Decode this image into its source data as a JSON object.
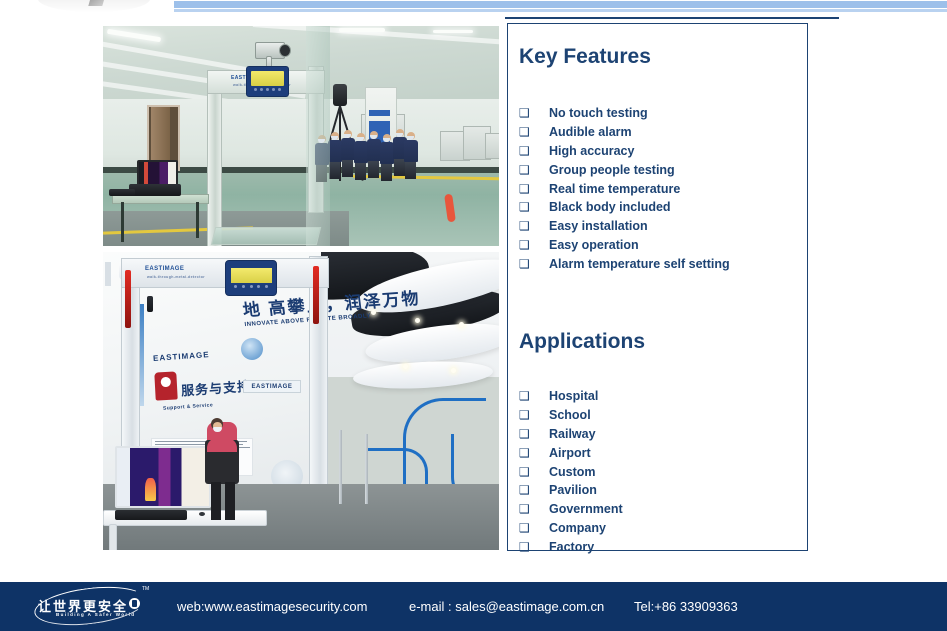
{
  "document": {
    "type": "product-brochure-slide",
    "brand": "EASTIMAGE",
    "accent_color": "#1d4373",
    "footer_color": "#0e3366",
    "header_bar_color": "#9dc0ea"
  },
  "header": {
    "logo_name": "eastimage-watermark-logo",
    "bar_name": "header-accent-bar",
    "rule_name": "header-navy-rule"
  },
  "photos": [
    {
      "name": "photo-factory-walkthrough-screening",
      "caption": "Indoor inspection hall with walk-through temperature screening gate, thermal monitor on table, black body calibrator on tripod and a group of masked workers in navy uniforms",
      "eastimage_label": "EASTIMAGE",
      "gate_display_type": "walk-through-metal-detector"
    },
    {
      "name": "photo-showroom-walkthrough-screening",
      "caption": "EASTIMAGE showroom with walk-through screening gate, wall signage, thermal imaging workstation and a masked visitor in a pink hooded jacket",
      "wall_sign_cn": "地 高攀上，润泽万物",
      "wall_sign_en": "INNOVATE ABOVE  RADIATE BROADLY",
      "brand_label": "EASTIMAGE",
      "service_cn": "服务与支持",
      "service_en": "Support & Service"
    }
  ],
  "panel": {
    "key_features": {
      "heading": "Key Features",
      "bullet_glyph": "❑",
      "items": [
        "No touch testing",
        "Audible alarm",
        "High accuracy",
        "Group people testing",
        "Real time temperature",
        "Black body included",
        "Easy installation",
        "Easy operation",
        "Alarm temperature self setting"
      ]
    },
    "applications": {
      "heading": "Applications",
      "bullet_glyph": "❑",
      "items": [
        "Hospital",
        "School",
        "Railway",
        "Airport",
        "Custom",
        "Pavilion",
        "Government",
        "Company",
        "Factory"
      ]
    }
  },
  "footer": {
    "logo": {
      "chinese": "让世界更安全",
      "english": "Building A Safer World",
      "trademark": "TM"
    },
    "web": "web:www.eastimagesecurity.com",
    "email": "e-mail : sales@eastimage.com.cn",
    "tel": "Tel:+86 33909363"
  }
}
